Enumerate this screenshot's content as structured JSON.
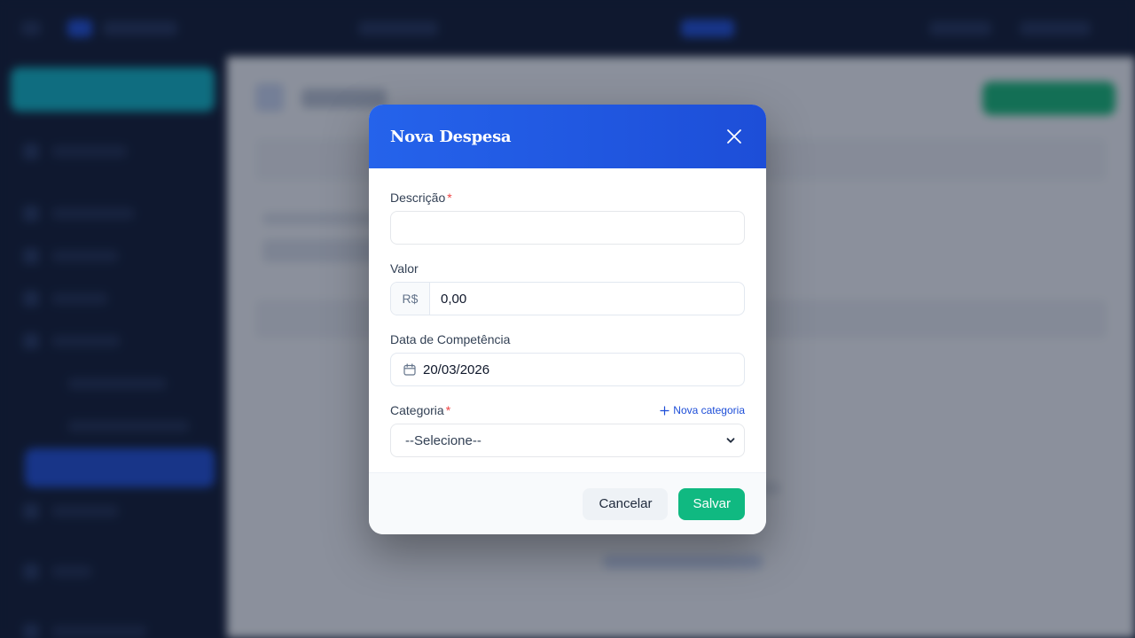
{
  "modal": {
    "title": "Nova Despesa",
    "descricao": {
      "label": "Descrição",
      "required_mark": "*",
      "value": ""
    },
    "valor": {
      "label": "Valor",
      "prefix": "R$",
      "value": "0,00"
    },
    "data": {
      "label": "Data de Competência",
      "value": "20/03/2026"
    },
    "categoria": {
      "label": "Categoria",
      "required_mark": "*",
      "add_link": "Nova categoria",
      "selected": "--Selecione--"
    },
    "buttons": {
      "cancel": "Cancelar",
      "save": "Salvar"
    }
  },
  "colors": {
    "header": "#2563eb",
    "save": "#10b981",
    "required": "#ef4444",
    "link": "#1d4ed8"
  },
  "icons": [
    "close-icon",
    "calendar-icon",
    "plus-icon",
    "chevron-down-icon"
  ]
}
